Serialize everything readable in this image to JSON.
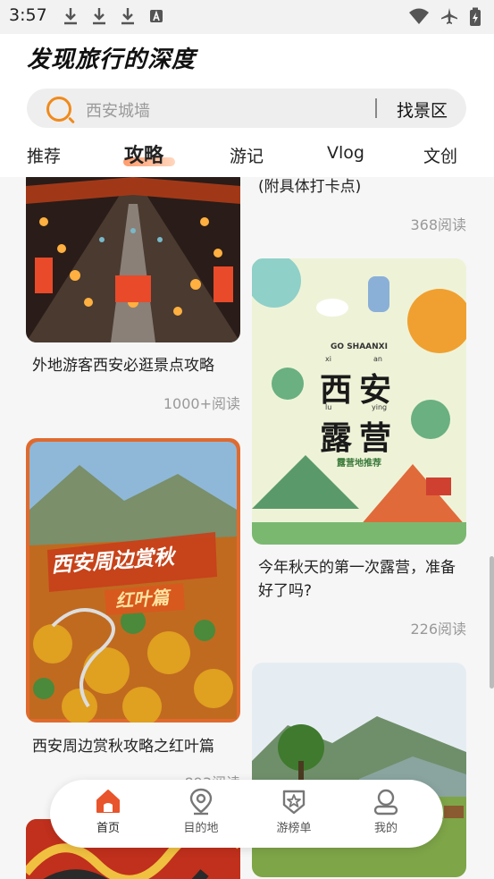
{
  "status_bar": {
    "time": "3:57"
  },
  "header": {
    "logo_text": "发现旅行的深度",
    "search": {
      "placeholder": "西安城墙",
      "action": "找景区"
    }
  },
  "tabs": [
    {
      "label": "推荐",
      "active": false
    },
    {
      "label": "攻略",
      "active": true
    },
    {
      "label": "游记",
      "active": false
    },
    {
      "label": "Vlog",
      "active": false
    },
    {
      "label": "文创",
      "active": false
    }
  ],
  "feed": {
    "left": [
      {
        "title": "外地游客西安必逛景点攻略",
        "reads": "1000+阅读"
      },
      {
        "title": "西安周边赏秋攻略之红叶篇",
        "reads": "893阅读",
        "cover_text": {
          "headline": "西安周边赏秋",
          "sub": "红叶篇"
        }
      },
      {
        "title": "",
        "reads": ""
      }
    ],
    "right": [
      {
        "title": "(附具体打卡点)",
        "reads": "368阅读"
      },
      {
        "title": "今年秋天的第一次露营，准备好了吗?",
        "reads": "226阅读",
        "cover_text": {
          "brand": "GO SHAANXI",
          "pinyin_top": [
            "xi",
            "an"
          ],
          "main_top": "西安",
          "pinyin_bottom": [
            "lu",
            "ying"
          ],
          "main_bottom": "露营",
          "sub": "露营地推荐"
        }
      },
      {
        "title": "",
        "reads": ""
      }
    ]
  },
  "bottom_nav": [
    {
      "label": "首页",
      "icon": "home-icon",
      "active": true
    },
    {
      "label": "目的地",
      "icon": "location-pin-icon",
      "active": false
    },
    {
      "label": "游榜单",
      "icon": "ranking-badge-icon",
      "active": false
    },
    {
      "label": "我的",
      "icon": "profile-icon",
      "active": false
    }
  ],
  "colors": {
    "accent": "#f08a1b",
    "active_tab_underline": "#ff7a3a",
    "home_icon": "#e8542b"
  }
}
